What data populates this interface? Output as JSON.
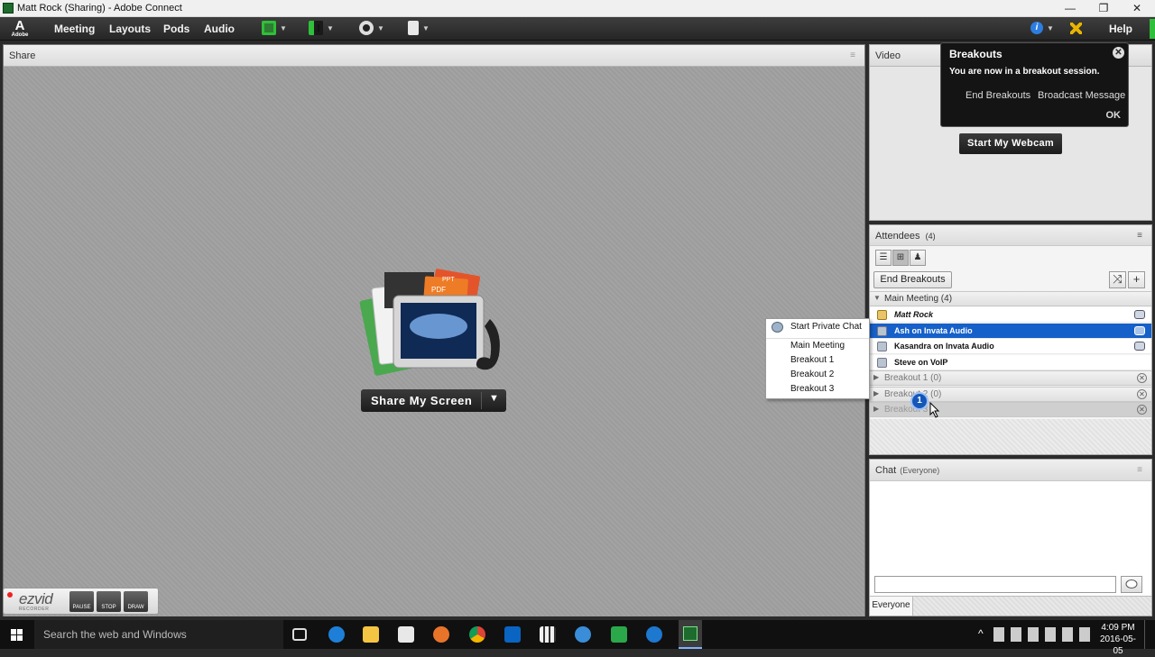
{
  "window": {
    "title": "Matt Rock (Sharing) - Adobe Connect",
    "minimize": "—",
    "restore": "❐",
    "close": "✕"
  },
  "menubar": {
    "logo_letter": "A",
    "logo_text": "Adobe",
    "items": [
      "Meeting",
      "Layouts",
      "Pods",
      "Audio"
    ],
    "help": "Help",
    "info_icon": "i",
    "dropdown_arrow": "▼"
  },
  "share_pod": {
    "title": "Share",
    "menu_icon": "≡",
    "doc_tag_pdf": "PDF",
    "doc_tag_ppt": "PPT",
    "share_button": "Share My Screen",
    "dropdown_arrow": "▼"
  },
  "video_pod": {
    "title": "Video",
    "webcam_button": "Start My Webcam"
  },
  "breakouts_popup": {
    "title": "Breakouts",
    "message": "You are now in a breakout session.",
    "close": "✕",
    "end_breakouts": "End Breakouts",
    "broadcast_message": "Broadcast Message",
    "ok": "OK"
  },
  "attendees_pod": {
    "title": "Attendees",
    "count": "(4)",
    "menu_icon": "≡",
    "view_icons": [
      "☰",
      "⊞",
      "♟"
    ],
    "end_breakouts_button": "End Breakouts",
    "shuffle_icon": "⤨",
    "add_icon": "+",
    "groups": [
      {
        "label": "Main Meeting (4)",
        "expanded": true,
        "arrow": "▼",
        "close": ""
      },
      {
        "label": "Breakout 1 (0)",
        "expanded": false,
        "arrow": "▶",
        "close": "✕"
      },
      {
        "label": "Breakout 2 (0)",
        "expanded": false,
        "arrow": "▶",
        "close": "✕"
      },
      {
        "label": "Breakout 3",
        "expanded": false,
        "arrow": "▶",
        "close": "✕"
      }
    ],
    "attendees": [
      {
        "name": "Matt Rock",
        "selected": false,
        "phone": true
      },
      {
        "name": "Ash on Invata Audio",
        "selected": true,
        "phone": true
      },
      {
        "name": "Kasandra on Invata Audio",
        "selected": false,
        "phone": true
      },
      {
        "name": "Steve on VoIP",
        "selected": false,
        "phone": false
      }
    ]
  },
  "context_menu": {
    "items": [
      "Start Private Chat",
      "Main Meeting",
      "Breakout 1",
      "Breakout 2",
      "Breakout 3"
    ]
  },
  "drag_badge": "1",
  "chat_pod": {
    "title": "Chat",
    "subtitle": "(Everyone)",
    "menu_icon": "≡",
    "footer_tab": "Everyone"
  },
  "ezvid": {
    "logo": "ezvid",
    "subtitle": "RECORDER",
    "buttons": [
      "PAUSE",
      "STOP",
      "DRAW"
    ]
  },
  "taskbar": {
    "search_placeholder": "Search the web and Windows",
    "time": "4:09 PM",
    "date": "2016-05-05",
    "tray_up": "^"
  },
  "colors": {
    "selection": "#1660c9",
    "accent_green": "#2fbf3a",
    "toolbar_dark": "#262626"
  }
}
